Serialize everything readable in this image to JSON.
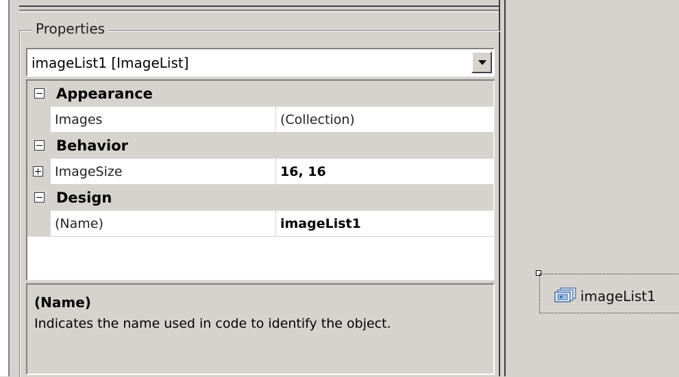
{
  "properties": {
    "title": "Properties",
    "selected_object": "imageList1 [ImageList]",
    "categories": [
      {
        "label": "Appearance",
        "items": [
          {
            "name": "Images",
            "value": "(Collection)",
            "bold_value": false,
            "expandable": false
          }
        ]
      },
      {
        "label": "Behavior",
        "items": [
          {
            "name": "ImageSize",
            "value": "16, 16",
            "bold_value": true,
            "expandable": true
          }
        ]
      },
      {
        "label": "Design",
        "items": [
          {
            "name": "(Name)",
            "value": "imageList1",
            "bold_value": true,
            "expandable": false
          }
        ]
      }
    ],
    "help": {
      "title": "(Name)",
      "description": "Indicates the name used in code to identify the object."
    }
  },
  "component_tray": {
    "item_label": "imageList1",
    "item_icon": "imagelist-icon"
  },
  "colors": {
    "control_face": "#d6d3ce",
    "grid_background": "#ffffff"
  }
}
